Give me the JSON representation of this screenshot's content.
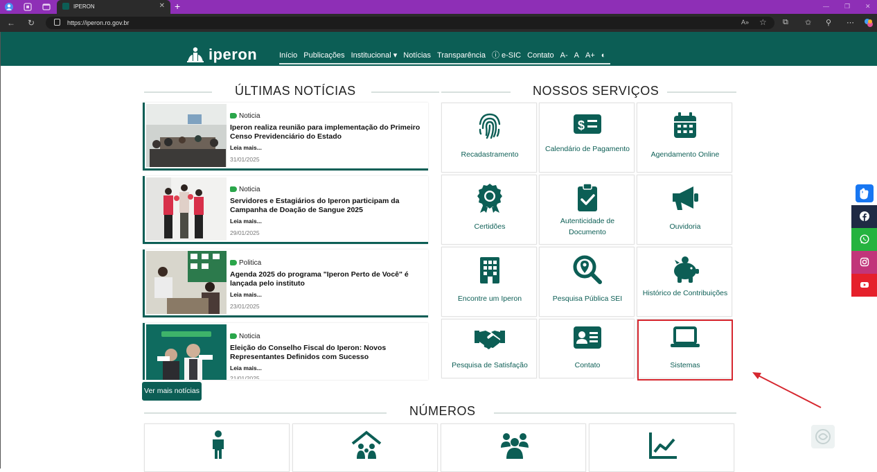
{
  "browser": {
    "tab_title": "IPERON",
    "url": "https://iperon.ro.gov.br"
  },
  "site": {
    "logo_text": "iperon",
    "menu": [
      "Início",
      "Publicações",
      "Institucional ▾",
      "Notícias",
      "Transparência",
      "ⓘ e-SIC",
      "Contato",
      "A-",
      "A",
      "A+",
      "◐"
    ]
  },
  "news": {
    "title": "ÚLTIMAS NOTÍCIAS",
    "items": [
      {
        "category": "Noticia",
        "headline": "Iperon realiza reunião para implementação do Primeiro Censo Previdenciário do Estado",
        "more": "Leia mais...",
        "date": "31/01/2025"
      },
      {
        "category": "Noticia",
        "headline": "Servidores e Estagiários do Iperon participam da Campanha de Doação de Sangue 2025",
        "more": "Leia mais...",
        "date": "29/01/2025"
      },
      {
        "category": "Politica",
        "headline": "Agenda 2025 do programa \"Iperon Perto de Você\" é lançada pelo instituto",
        "more": "Leia mais...",
        "date": "23/01/2025"
      },
      {
        "category": "Noticia",
        "headline": "Eleição do Conselho Fiscal do Iperon: Novos Representantes Definidos com Sucesso",
        "more": "Leia mais...",
        "date": "21/01/2025"
      }
    ],
    "more_button": "Ver mais notícias"
  },
  "services": {
    "title": "NOSSOS SERVIÇOS",
    "items": [
      {
        "label": "Recadastramento",
        "icon": "fingerprint-icon"
      },
      {
        "label": "Calendário de Pagamento",
        "icon": "money-bill-icon"
      },
      {
        "label": "Agendamento Online",
        "icon": "calendar-icon"
      },
      {
        "label": "Certidões",
        "icon": "certificate-icon"
      },
      {
        "label": "Autenticidade de Documento",
        "icon": "clipboard-check-icon"
      },
      {
        "label": "Ouvidoria",
        "icon": "megaphone-icon"
      },
      {
        "label": "Encontre um Iperon",
        "icon": "building-icon"
      },
      {
        "label": "Pesquisa Pública SEI",
        "icon": "search-location-icon"
      },
      {
        "label": "Histórico de Contribuições",
        "icon": "piggy-bank-icon"
      },
      {
        "label": "Pesquisa de Satisfação",
        "icon": "handshake-icon"
      },
      {
        "label": "Contato",
        "icon": "id-card-icon"
      },
      {
        "label": "Sistemas",
        "icon": "laptop-icon"
      }
    ]
  },
  "numbers": {
    "title": "NÚMEROS"
  },
  "colors": {
    "brand": "#0c5e55",
    "highlight": "#d6262e",
    "browser_frame": "#8e2fb6"
  }
}
